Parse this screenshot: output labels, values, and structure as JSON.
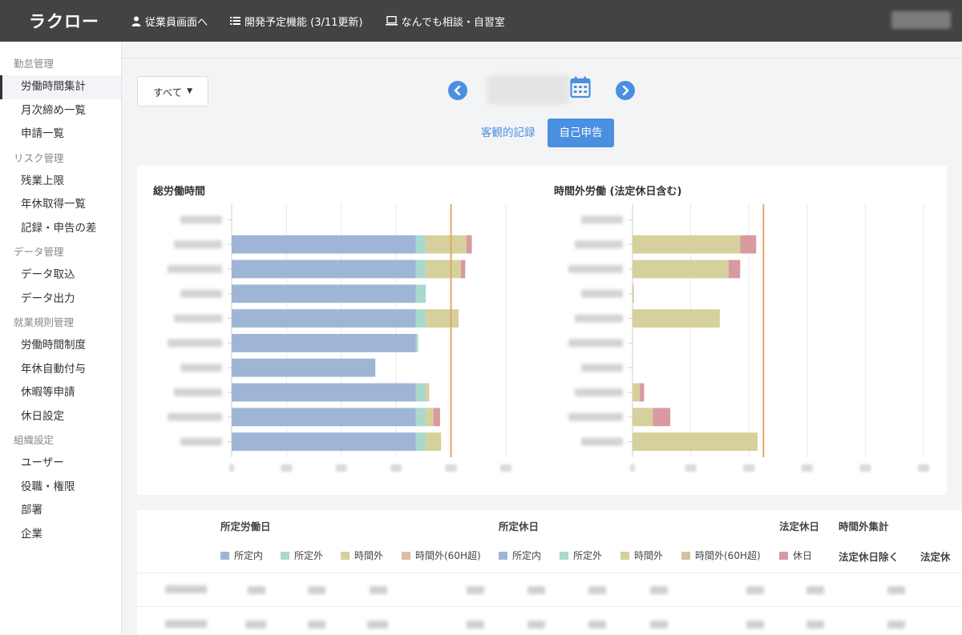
{
  "app": {
    "logo": "ラクロー"
  },
  "topnav": {
    "items": [
      {
        "icon": "user-icon",
        "label": "従業員画面へ"
      },
      {
        "icon": "list-icon",
        "label": "開発予定機能 (3/11更新)"
      },
      {
        "icon": "laptop-icon",
        "label": "なんでも相談・自習室"
      }
    ]
  },
  "sidebar": {
    "sections": [
      {
        "title": "勤怠管理",
        "items": [
          "労働時間集計",
          "月次締め一覧",
          "申請一覧"
        ]
      },
      {
        "title": "リスク管理",
        "items": [
          "残業上限",
          "年休取得一覧",
          "記録・申告の差"
        ]
      },
      {
        "title": "データ管理",
        "items": [
          "データ取込",
          "データ出力"
        ]
      },
      {
        "title": "就業規則管理",
        "items": [
          "労働時間制度",
          "年休自動付与",
          "休暇等申請",
          "休日設定"
        ]
      },
      {
        "title": "組織設定",
        "items": [
          "ユーザー",
          "役職・権限",
          "部署",
          "企業"
        ]
      }
    ],
    "active_item": "労働時間集計"
  },
  "toolbar": {
    "filter_label": "すべて",
    "tab_objective": "客観的記録",
    "tab_self": "自己申告"
  },
  "colors": {
    "accent": "#4a8fe0",
    "within": "#9fb5d6",
    "outside": "#a9d8cd",
    "overtime": "#d6d09c",
    "overtime60": "#d8bfa3",
    "holiday": "#d89aa0",
    "limit_line": "#e0a86a"
  },
  "chart_data": [
    {
      "type": "bar",
      "orientation": "horizontal",
      "stacked": true,
      "title": "総労働時間",
      "xlim": [
        0,
        250
      ],
      "limit_line": 200,
      "categories_count": 10,
      "series": [
        {
          "name": "所定内",
          "values": [
            0,
            168,
            168,
            168,
            168,
            168,
            131,
            168,
            168,
            168
          ]
        },
        {
          "name": "所定外",
          "values": [
            0,
            9,
            9,
            9,
            9,
            2,
            0,
            9,
            9,
            9
          ]
        },
        {
          "name": "時間外",
          "values": [
            0,
            37,
            32,
            0,
            30,
            0,
            0,
            2,
            7,
            14
          ]
        },
        {
          "name": "時間外(60H超)",
          "values": [
            0,
            0,
            0,
            0,
            0,
            0,
            0,
            1,
            0,
            0
          ]
        },
        {
          "name": "休日",
          "values": [
            0,
            5,
            4,
            0,
            0,
            0,
            0,
            0,
            6,
            0
          ]
        }
      ]
    },
    {
      "type": "bar",
      "orientation": "horizontal",
      "stacked": true,
      "title": "時間外労働 (法定休日含む)",
      "xlim": [
        0,
        100
      ],
      "limit_line": 45,
      "categories_count": 10,
      "series": [
        {
          "name": "時間外",
          "values": [
            0,
            37,
            33,
            0.5,
            30,
            0,
            0,
            2.5,
            7,
            43
          ]
        },
        {
          "name": "休日",
          "values": [
            0,
            5.5,
            4,
            0,
            0,
            0,
            0,
            1.5,
            6,
            0
          ]
        }
      ]
    }
  ],
  "table": {
    "group_headers": [
      "所定労働日",
      "所定休日",
      "法定休日",
      "時間外集計"
    ],
    "legend_a": [
      "所定内",
      "所定外",
      "時間外",
      "時間外(60H超)"
    ],
    "legend_b": [
      "所定内",
      "所定外",
      "時間外",
      "時間外(60H超)"
    ],
    "legend_c": [
      "休日"
    ],
    "sub_headers": [
      "法定休日除く",
      "法定休"
    ]
  }
}
